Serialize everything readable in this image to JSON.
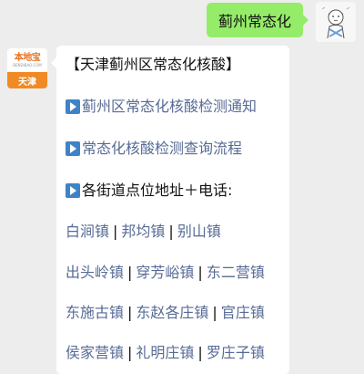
{
  "outgoing": {
    "text": "蓟州常态化"
  },
  "incoming": {
    "avatar": {
      "logo": "本地宝",
      "logo_sub": "BENDIBAO.COM",
      "city": "天津"
    },
    "title": "【天津蓟州区常态化核酸】",
    "links": [
      "蓟州区常态化核酸检测通知",
      "常态化核酸检测查询流程"
    ],
    "section_header": "各街道点位地址＋电话:",
    "towns": [
      [
        "白涧镇",
        "邦均镇",
        "别山镇"
      ],
      [
        "出头岭镇",
        "穿芳峪镇",
        "东二营镇"
      ],
      [
        "东施古镇",
        "东赵各庄镇",
        "官庄镇"
      ],
      [
        "侯家营镇",
        "礼明庄镇",
        "罗庄子镇"
      ]
    ],
    "separator": "|"
  },
  "colors": {
    "link": "#576b95",
    "bubble_out": "#95ec69",
    "background": "#ededed",
    "play_icon": "#3e83c7"
  }
}
